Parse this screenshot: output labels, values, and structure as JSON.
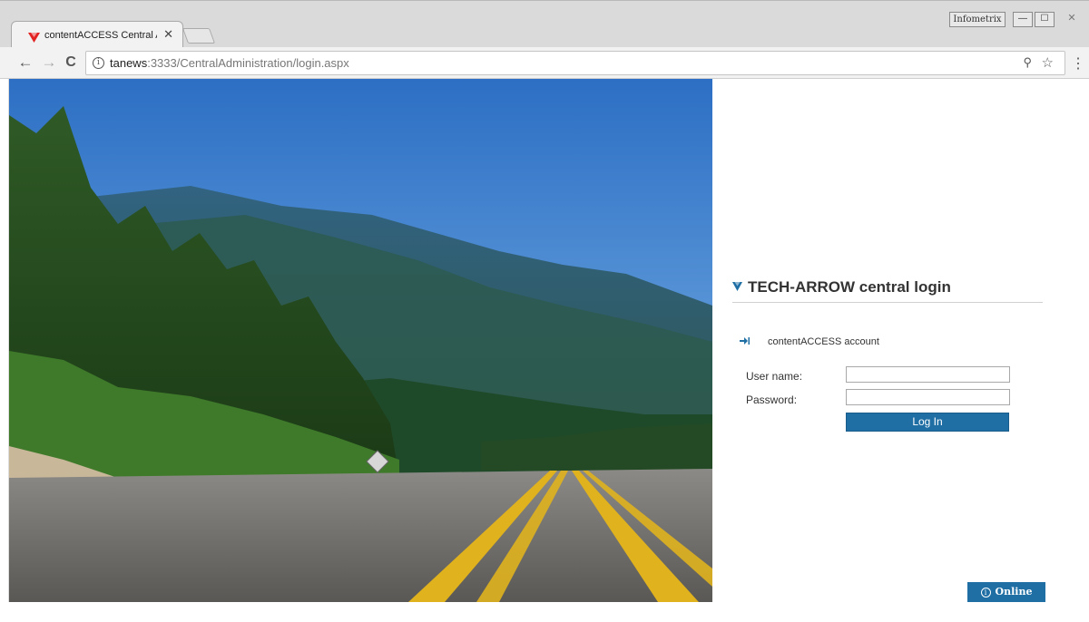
{
  "window": {
    "profile_label": "Infometrix",
    "minimize_glyph": "—",
    "maximize_glyph": "☐",
    "close_glyph": "✕"
  },
  "tab": {
    "title": "contentACCESS Central Ad",
    "close_glyph": "✕"
  },
  "toolbar": {
    "back_glyph": "←",
    "forward_glyph": "→",
    "reload_glyph": "C",
    "info_glyph": "i",
    "url_host": "tanews",
    "url_rest": ":3333/CentralAdministration/login.aspx",
    "zoom_glyph": "⚲",
    "star_glyph": "☆",
    "menu_glyph": "⋮"
  },
  "login": {
    "title": "TECH-ARROW central login",
    "account_label": "contentACCESS account",
    "username_label": "User name:",
    "username_value": "",
    "password_label": "Password:",
    "password_value": "",
    "submit_label": "Log In"
  },
  "footer": {
    "help_label": "Online help",
    "help_glyph": "i"
  },
  "colors": {
    "brand_blue": "#1f6fa5",
    "logo_red": "#e32222"
  },
  "icons": {
    "favicon": "tech-arrow-logo-icon",
    "brand": "tech-arrow-logo-icon",
    "account": "sign-in-arrow-icon",
    "help": "info-icon"
  }
}
